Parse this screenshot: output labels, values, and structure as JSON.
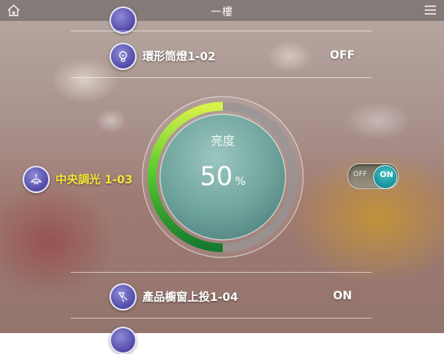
{
  "header": {
    "title": "一樓",
    "home_icon": "home-icon",
    "menu_icon": "menu-icon"
  },
  "devices": [
    {
      "label": "環形筒燈1-02",
      "state": "OFF",
      "icon": "bulb-icon"
    },
    {
      "label": "中央調光 1-03",
      "icon": "ceiling-lamp-icon",
      "highlighted": true,
      "highlight_color": "#f3e53a"
    },
    {
      "label": "產品櫥窗上投1-04",
      "state": "ON",
      "icon": "spotlight-icon"
    }
  ],
  "dimmer": {
    "label": "亮度",
    "value": "50",
    "unit": "%",
    "level_fraction": 0.5
  },
  "toggle": {
    "off_label": "OFF",
    "on_label": "ON",
    "state": "on"
  },
  "colors": {
    "accent": "#1fa3a8",
    "arc_start": "#147a2e",
    "arc_end": "#d8f24a",
    "highlight": "#f3e53a"
  }
}
